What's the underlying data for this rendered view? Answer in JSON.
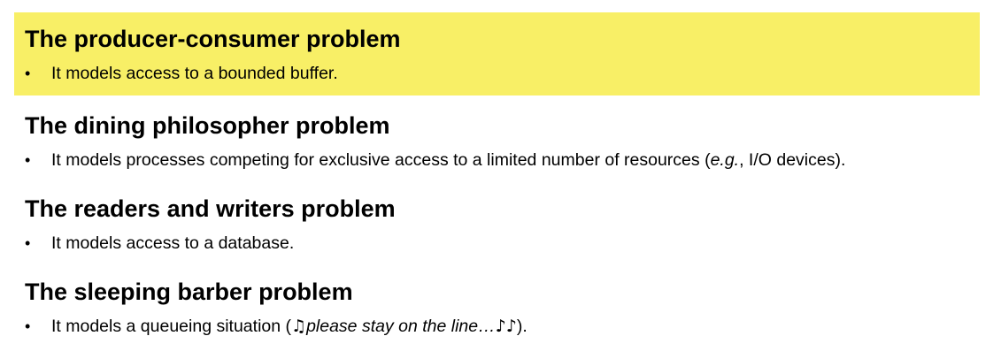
{
  "sections": [
    {
      "heading": "The producer-consumer problem",
      "highlighted": true,
      "highlight_color": "#f8ef66",
      "bullet": "It models access to a bounded buffer."
    },
    {
      "heading": "The dining philosopher problem",
      "highlighted": false,
      "bullet_pre": "It models processes competing for exclusive access to a limited number of resources (",
      "bullet_italic": "e.g.",
      "bullet_post": ", I/O devices)."
    },
    {
      "heading": "The readers and writers problem",
      "highlighted": false,
      "bullet": "It models access to a database."
    },
    {
      "heading": "The sleeping barber problem",
      "highlighted": false,
      "bullet_pre": "It models a queueing situation (",
      "music_icon_1": "♫",
      "bullet_italic": "please stay on the line…",
      "music_icon_2": "♪♪",
      "bullet_post": ")."
    }
  ],
  "bullet_symbol": "•"
}
